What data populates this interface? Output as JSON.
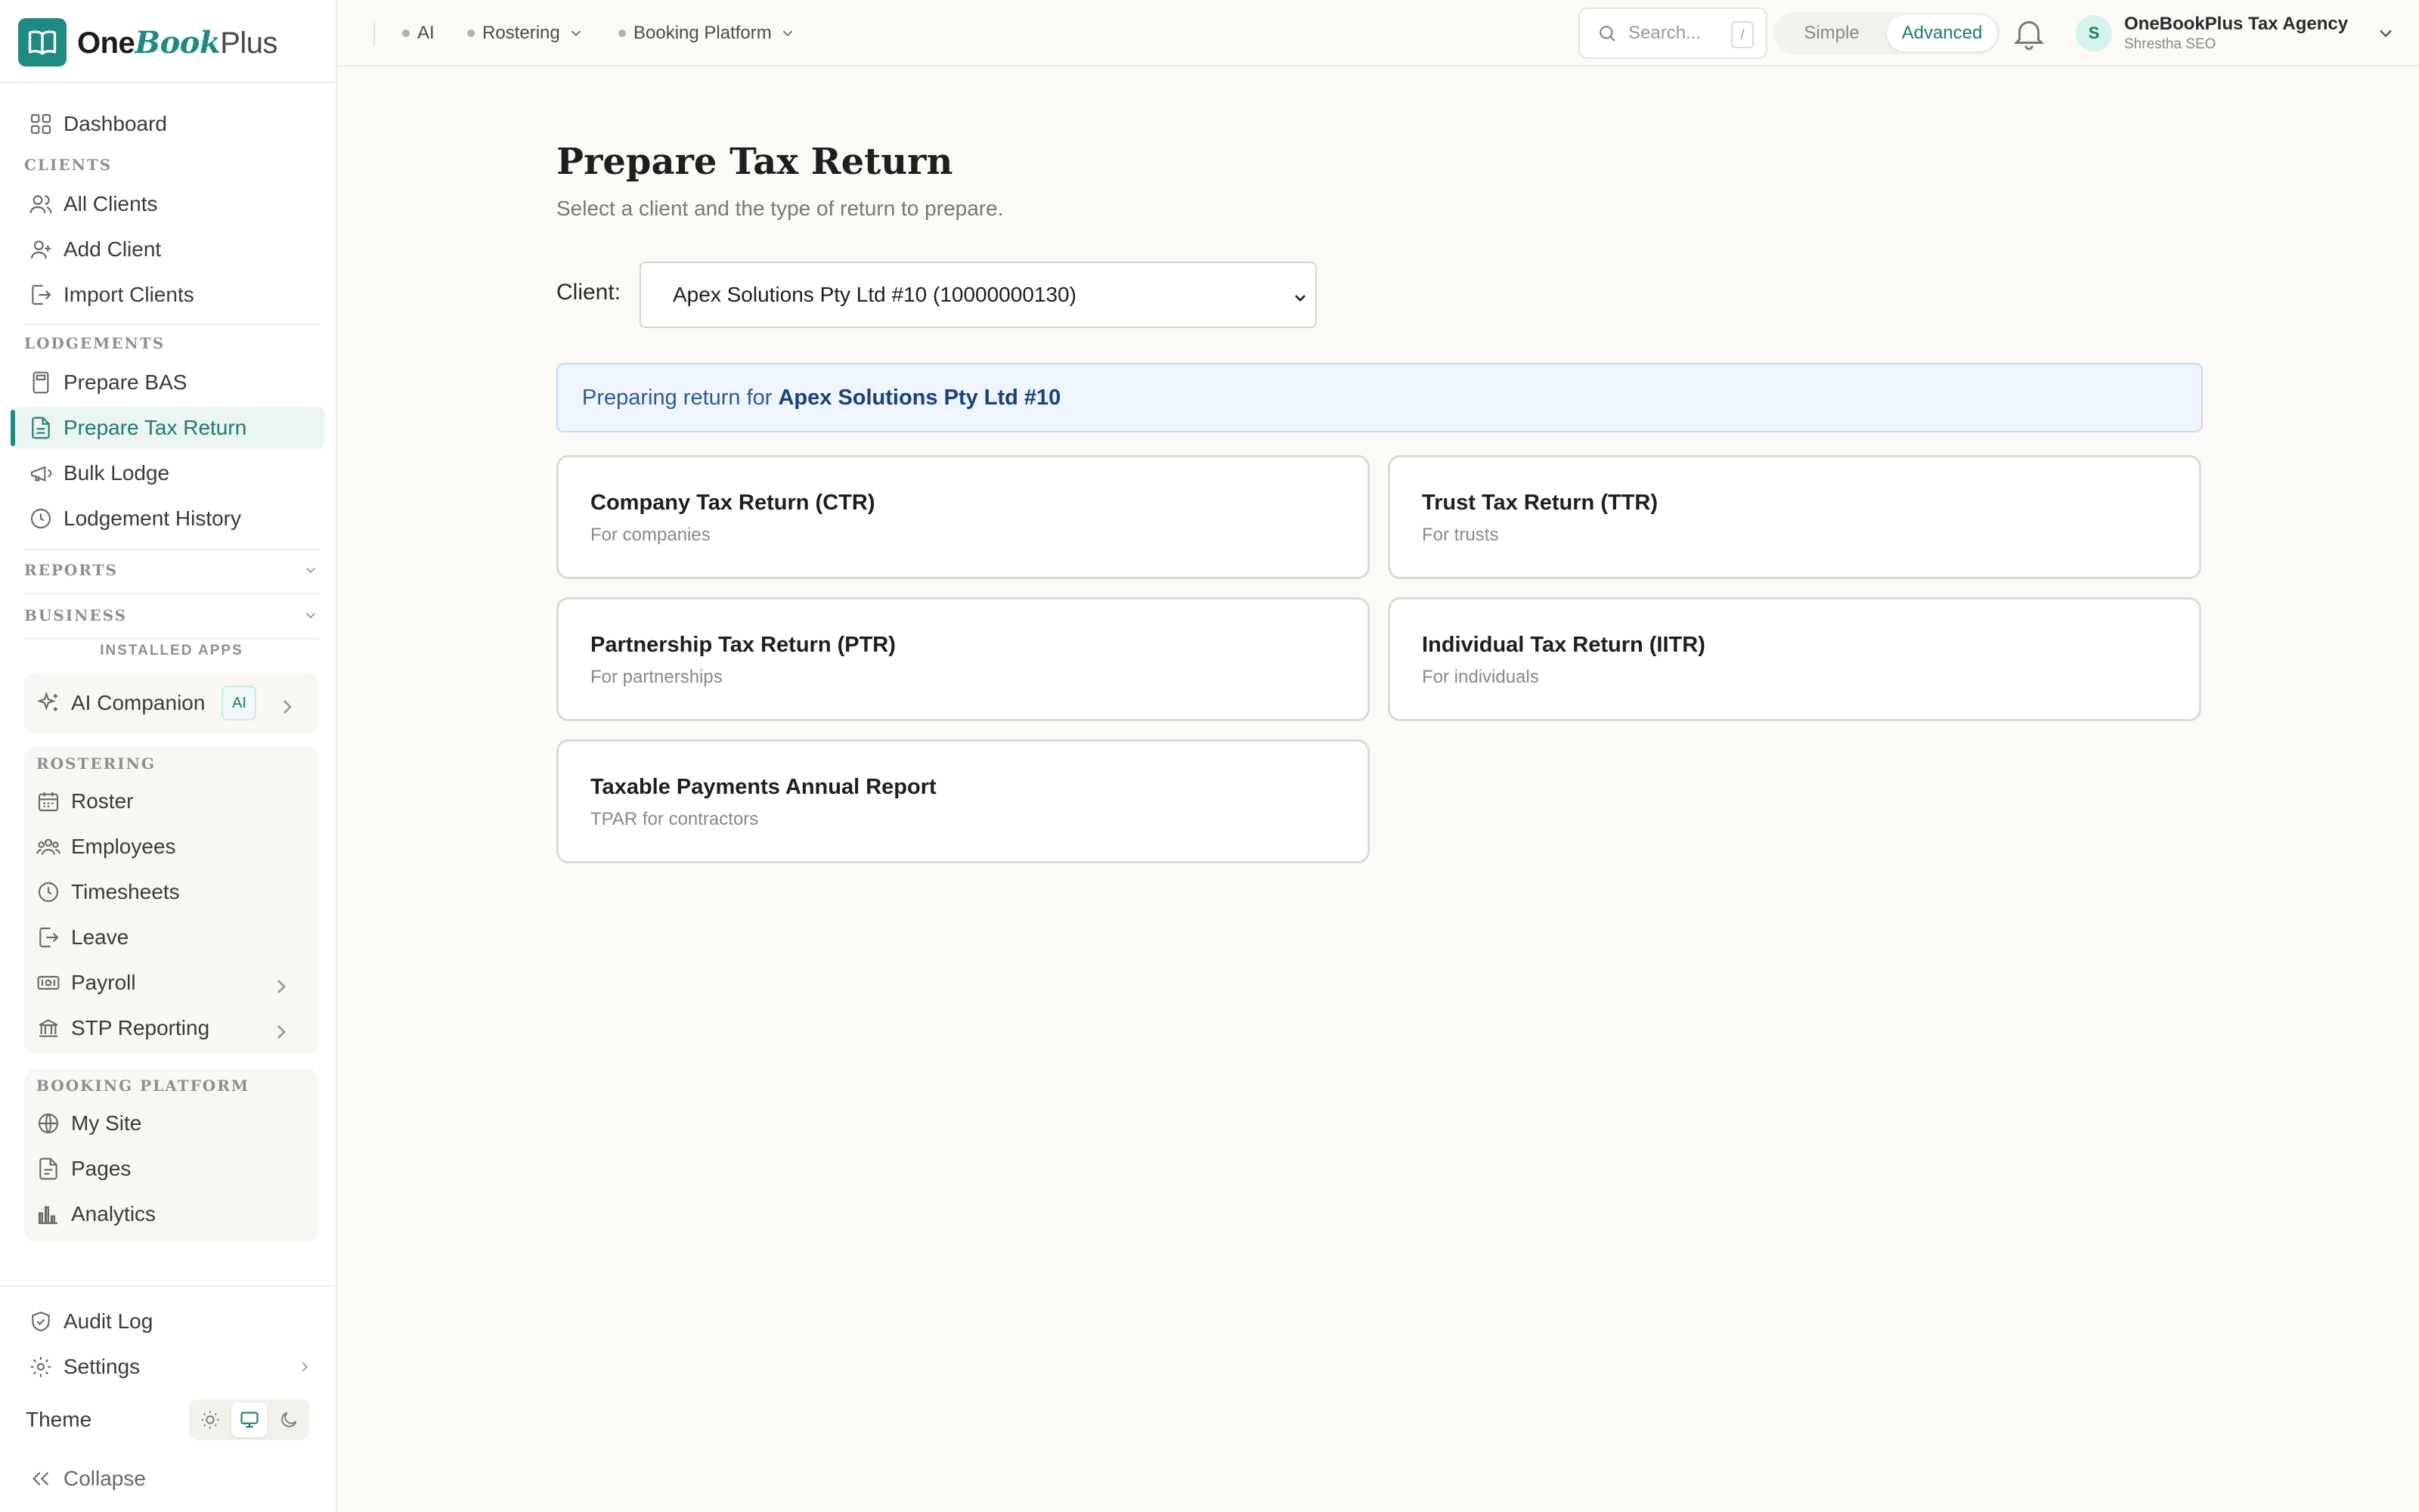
{
  "brand": {
    "one": "One",
    "book": "Book",
    "plus": "Plus"
  },
  "sidebar": {
    "dashboard": "Dashboard",
    "sections": {
      "clients": "CLIENTS",
      "lodgements": "LODGEMENTS",
      "reports": "REPORTS",
      "business": "BUSINESS",
      "installed_apps": "INSTALLED APPS",
      "rostering": "ROSTERING",
      "booking_platform": "BOOKING PLATFORM"
    },
    "clients_items": [
      "All Clients",
      "Add Client",
      "Import Clients"
    ],
    "lodgement_items": [
      "Prepare BAS",
      "Prepare Tax Return",
      "Bulk Lodge",
      "Lodgement History"
    ],
    "ai_companion": {
      "label": "AI Companion",
      "badge": "AI"
    },
    "rostering_items": [
      "Roster",
      "Employees",
      "Timesheets",
      "Leave",
      "Payroll",
      "STP Reporting"
    ],
    "booking_items": [
      "My Site",
      "Pages",
      "Analytics"
    ],
    "audit_log": "Audit Log",
    "settings": "Settings",
    "theme_label": "Theme",
    "collapse": "Collapse"
  },
  "topbar": {
    "nav": [
      "AI",
      "Rostering",
      "Booking Platform"
    ],
    "search_placeholder": "Search...",
    "search_shortcut": "/",
    "mode": {
      "simple": "Simple",
      "advanced": "Advanced",
      "selected": "Advanced"
    },
    "account": {
      "initial": "S",
      "name": "OneBookPlus Tax Agency",
      "role": "Shrestha SEO"
    }
  },
  "main": {
    "title": "Prepare Tax Return",
    "subtitle": "Select a client and the type of return to prepare.",
    "client_label": "Client:",
    "client_selected": "Apex Solutions Pty Ltd #10 (10000000130)",
    "banner_prefix": "Preparing return for",
    "banner_client": "Apex Solutions Pty Ltd #10",
    "cards": [
      {
        "title": "Company Tax Return (CTR)",
        "subtitle": "For companies"
      },
      {
        "title": "Trust Tax Return (TTR)",
        "subtitle": "For trusts"
      },
      {
        "title": "Partnership Tax Return (PTR)",
        "subtitle": "For partnerships"
      },
      {
        "title": "Individual Tax Return (IITR)",
        "subtitle": "For individuals"
      },
      {
        "title": "Taxable Payments Annual Report",
        "subtitle": "TPAR for contractors"
      }
    ]
  },
  "colors": {
    "accent": "#1f8a80",
    "banner_bg": "#eef5fd",
    "banner_text": "#1a3f7c"
  }
}
